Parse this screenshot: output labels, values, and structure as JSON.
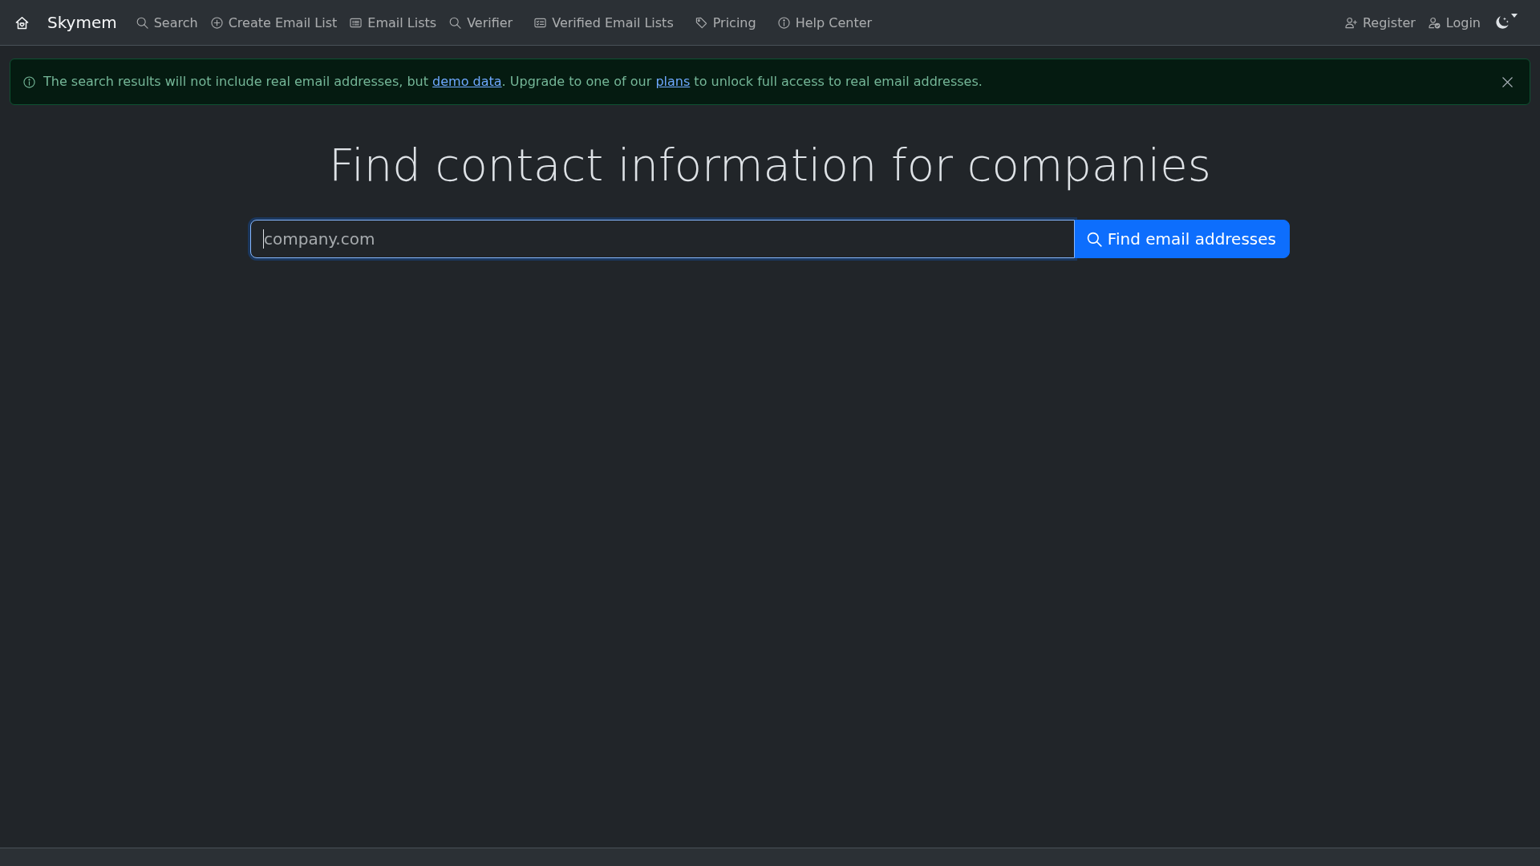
{
  "navbar": {
    "brand": "Skymem",
    "links": [
      "Search",
      "Create Email List",
      "Email Lists",
      "Verifier",
      "Verified Email Lists",
      "Pricing",
      "Help Center"
    ],
    "account_links": [
      "Register",
      "Login"
    ]
  },
  "alert": {
    "parts": [
      {
        "kind": "text",
        "text": "The search results will not include real email addresses, but "
      },
      {
        "kind": "link",
        "text": "demo data"
      },
      {
        "kind": "text",
        "text": ". Upgrade to one of our "
      },
      {
        "kind": "link",
        "text": "plans"
      },
      {
        "kind": "text",
        "text": " to unlock full access to real email addresses."
      }
    ]
  },
  "heading": "Find contact information for companies",
  "search": {
    "placeholder": "company.com",
    "focused": true,
    "button": "Find email addresses"
  }
}
